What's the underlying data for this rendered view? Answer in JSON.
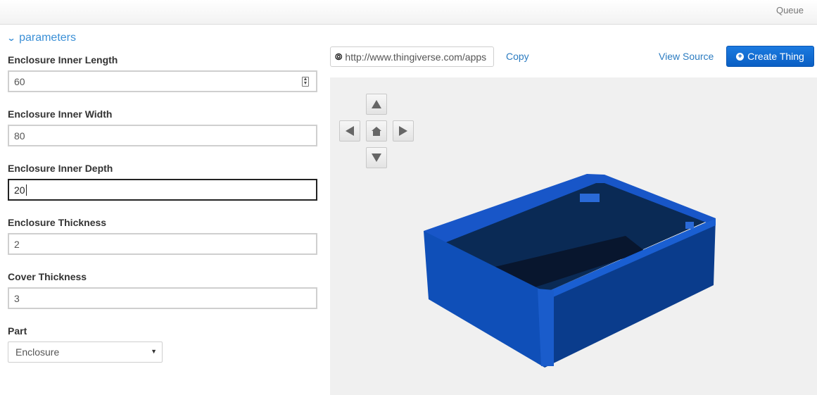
{
  "topbar": {
    "queue_label": "Queue"
  },
  "parameters": {
    "header": "parameters",
    "fields": [
      {
        "label": "Enclosure Inner Length",
        "value": "60"
      },
      {
        "label": "Enclosure Inner Width",
        "value": "80"
      },
      {
        "label": "Enclosure Inner Depth",
        "value": "20"
      },
      {
        "label": "Enclosure Thickness",
        "value": "2"
      },
      {
        "label": "Cover Thickness",
        "value": "3"
      }
    ],
    "part": {
      "label": "Part",
      "selected": "Enclosure"
    }
  },
  "toolbar": {
    "url": "http://www.thingiverse.com/apps",
    "copy_label": "Copy",
    "view_source_label": "View Source",
    "create_label": "Create Thing"
  },
  "viewer": {
    "model_color": "#0d4fb0",
    "nav_icons": [
      "arrow-up-icon",
      "arrow-left-icon",
      "home-icon",
      "arrow-right-icon",
      "arrow-down-icon"
    ]
  }
}
